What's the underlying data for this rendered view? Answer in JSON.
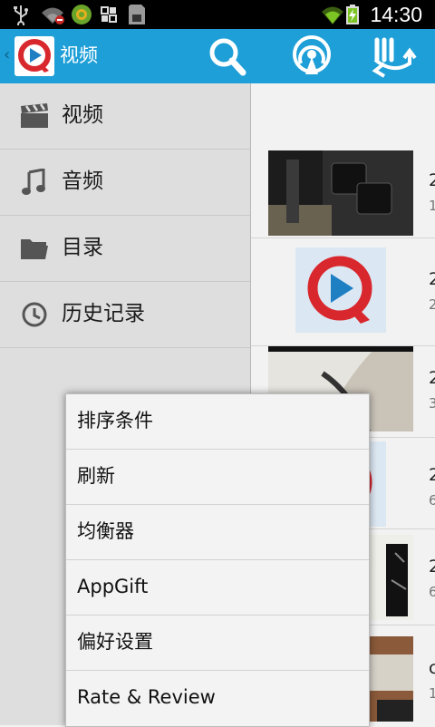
{
  "status_bar": {
    "time": "14:30",
    "icons": [
      "usb-icon",
      "wifi-alert-icon",
      "green-circle-app-icon",
      "apps-grid-icon",
      "sd-card-icon",
      "wifi-signal-icon",
      "battery-charging-icon"
    ]
  },
  "app_bar": {
    "title": "视频",
    "actions": [
      "search-icon",
      "broadcast-icon",
      "sort-icon"
    ],
    "colors": {
      "bar": "#1e9fd8",
      "logo_red": "#d9272e",
      "logo_blue": "#1e7fc3"
    }
  },
  "drawer": {
    "items": [
      {
        "label": "视频",
        "icon": "clapperboard-icon"
      },
      {
        "label": "音频",
        "icon": "music-note-icon"
      },
      {
        "label": "目录",
        "icon": "folder-icon"
      },
      {
        "label": "历史记录",
        "icon": "clock-icon"
      }
    ]
  },
  "media_list": {
    "rows": [
      {
        "title": "2",
        "subtitle": "1"
      },
      {
        "title": "2",
        "subtitle": "2"
      },
      {
        "title": "2",
        "subtitle": "3"
      },
      {
        "title": "2",
        "subtitle": "6"
      },
      {
        "title": "2",
        "subtitle": "6"
      },
      {
        "title": "c",
        "subtitle": "1"
      }
    ]
  },
  "menu": {
    "items": [
      "排序条件",
      "刷新",
      "均衡器",
      "AppGift",
      "偏好设置",
      "Rate & Review"
    ]
  }
}
